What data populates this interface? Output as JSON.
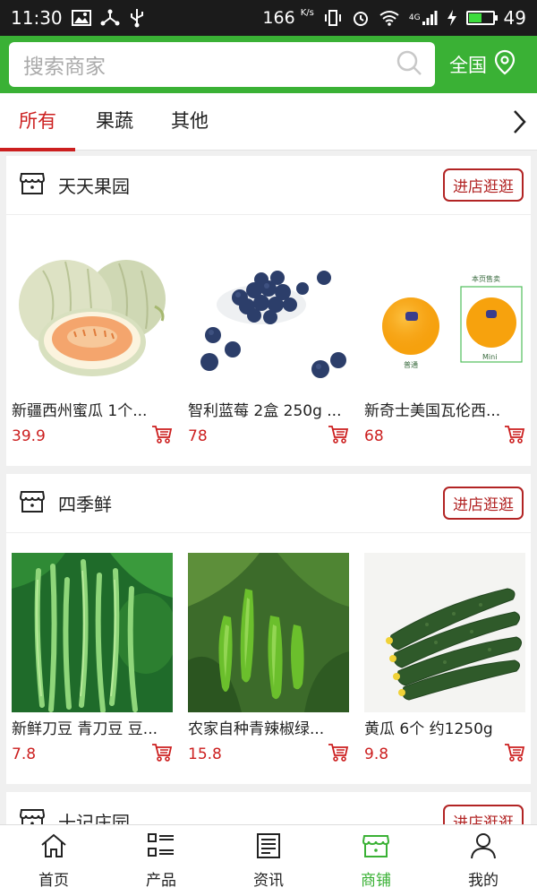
{
  "status_bar": {
    "time": "11:30",
    "speed": "166",
    "speed_unit": "K/s",
    "network": "4G",
    "battery": "49",
    "battery_level": 0.49
  },
  "header": {
    "search_placeholder": "搜索商家",
    "region": "全国",
    "accent_color": "#3ab135"
  },
  "tabs": [
    "所有",
    "果蔬",
    "其他"
  ],
  "shops": [
    {
      "name": "天天果园",
      "visit_label": "进店逛逛",
      "products": [
        {
          "name": "新疆西州蜜瓜 1个...",
          "price": "39.9",
          "image": "melon"
        },
        {
          "name": "智利蓝莓 2盒 250g ...",
          "price": "78",
          "image": "blueberries"
        },
        {
          "name": "新奇士美国瓦伦西...",
          "price": "68",
          "image": "oranges",
          "image_labels": {
            "tag": "本页售卖",
            "left": "普通",
            "right": "Mini"
          }
        }
      ]
    },
    {
      "name": "四季鲜",
      "visit_label": "进店逛逛",
      "products": [
        {
          "name": "新鲜刀豆 青刀豆 豆...",
          "price": "7.8",
          "image": "green-beans"
        },
        {
          "name": "农家自种青辣椒绿...",
          "price": "15.8",
          "image": "green-peppers"
        },
        {
          "name": "黄瓜 6个 约1250g",
          "price": "9.8",
          "image": "cucumbers"
        }
      ]
    },
    {
      "name": "十记庄园",
      "visit_label": "进店逛逛"
    }
  ],
  "bottom_nav": [
    {
      "label": "首页",
      "icon": "home-icon"
    },
    {
      "label": "产品",
      "icon": "list-icon"
    },
    {
      "label": "资讯",
      "icon": "news-icon"
    },
    {
      "label": "商铺",
      "icon": "store-icon"
    },
    {
      "label": "我的",
      "icon": "user-icon"
    }
  ],
  "colors": {
    "price": "#cc1f1f",
    "active_tab": "#cc1f1f",
    "nav_active": "#3ab135"
  }
}
